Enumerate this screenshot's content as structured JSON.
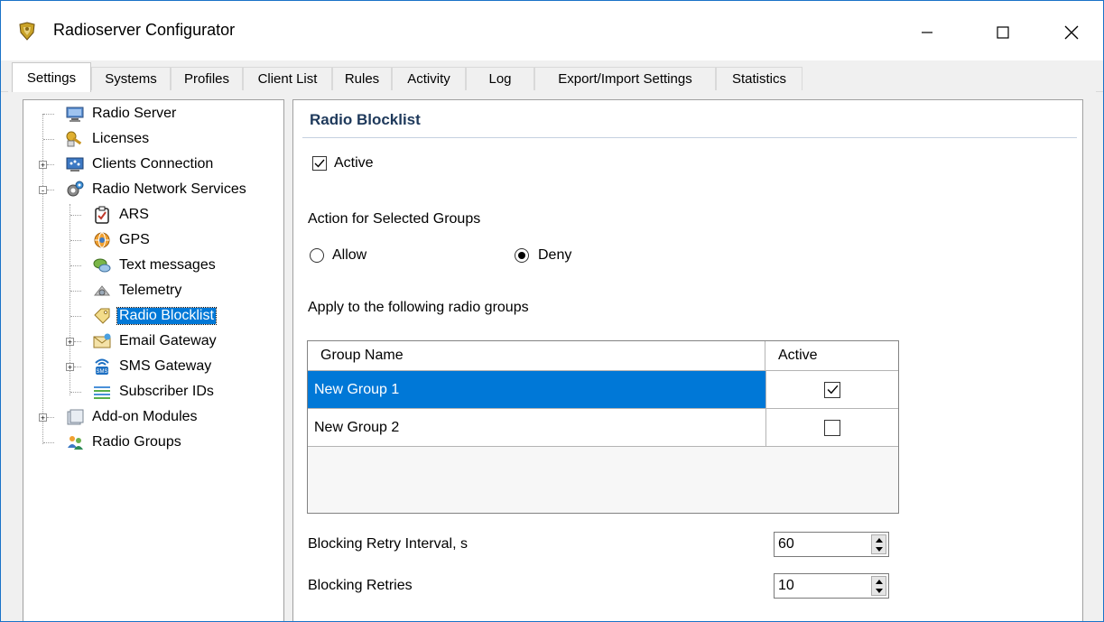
{
  "window": {
    "title": "Radioserver Configurator"
  },
  "tabs": [
    {
      "label": "Settings",
      "active": true
    },
    {
      "label": "Systems"
    },
    {
      "label": "Profiles"
    },
    {
      "label": "Client List"
    },
    {
      "label": "Rules"
    },
    {
      "label": "Activity"
    },
    {
      "label": "Log"
    },
    {
      "label": "Export/Import Settings"
    },
    {
      "label": "Statistics"
    }
  ],
  "tree": {
    "items": [
      {
        "label": "Radio Server",
        "icon": "server-icon"
      },
      {
        "label": "Licenses",
        "icon": "license-key-icon"
      },
      {
        "label": "Clients Connection",
        "icon": "network-monitor-icon",
        "expander": "+"
      },
      {
        "label": "Radio Network Services",
        "icon": "gear-services-icon",
        "expander": "-"
      },
      {
        "label": "ARS",
        "icon": "clipboard-check-icon"
      },
      {
        "label": "GPS",
        "icon": "globe-icon"
      },
      {
        "label": "Text messages",
        "icon": "chat-bubbles-icon"
      },
      {
        "label": "Telemetry",
        "icon": "telemetry-icon"
      },
      {
        "label": "Radio Blocklist",
        "icon": "tag-icon",
        "selected": true
      },
      {
        "label": "Email Gateway",
        "icon": "envelope-icon",
        "expander": "+"
      },
      {
        "label": "SMS Gateway",
        "icon": "sms-icon",
        "expander": "+"
      },
      {
        "label": "Subscriber IDs",
        "icon": "list-icon"
      },
      {
        "label": "Add-on Modules",
        "icon": "modules-icon",
        "expander": "+"
      },
      {
        "label": "Radio Groups",
        "icon": "users-group-icon"
      }
    ]
  },
  "panel": {
    "title": "Radio Blocklist",
    "active_label": "Active",
    "active_checked": true,
    "action_heading": "Action for Selected Groups",
    "allow_label": "Allow",
    "deny_label": "Deny",
    "selected_action": "Deny",
    "groups_heading": "Apply to the following radio groups",
    "grid": {
      "columns": [
        "Group Name",
        "Active"
      ],
      "rows": [
        {
          "name": "New Group 1",
          "active": true,
          "selected": true
        },
        {
          "name": "New Group 2",
          "active": false
        }
      ]
    },
    "retry_interval_label": "Blocking Retry Interval, s",
    "retry_interval_value": "60",
    "retries_label": "Blocking Retries",
    "retries_value": "10"
  },
  "colors": {
    "selection": "#0078d7",
    "window_border": "#1a73c8",
    "panel_title": "#1e395b"
  }
}
